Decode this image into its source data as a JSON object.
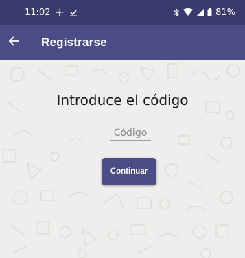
{
  "status_bar": {
    "time": "11:02",
    "battery": "81%",
    "icons": [
      "grid-icon",
      "download-check-icon",
      "bluetooth-icon",
      "wifi-icon",
      "signal-icon",
      "battery-icon"
    ]
  },
  "app_bar": {
    "title": "Registrarse",
    "back_icon": "back-arrow-icon",
    "color": "#4c4c86"
  },
  "main": {
    "heading": "Introduce el código",
    "code_placeholder": "Código",
    "code_value": "",
    "continue_label": "Continuar"
  },
  "colors": {
    "status_bar": "#3a3a6e",
    "primary": "#4c4c86",
    "background": "#efeeec"
  }
}
